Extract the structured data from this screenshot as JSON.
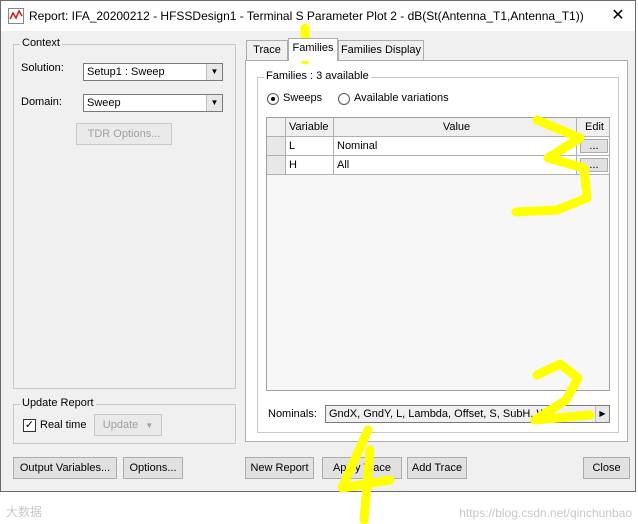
{
  "window": {
    "title": "Report: IFA_20200212 - HFSSDesign1 - Terminal S Parameter Plot 2 - dB(St(Antenna_T1,Antenna_T1))",
    "close_glyph": "✕"
  },
  "context": {
    "group_label": "Context",
    "solution_label": "Solution:",
    "solution_value": "Setup1 : Sweep",
    "domain_label": "Domain:",
    "domain_value": "Sweep",
    "tdr_button": "TDR Options..."
  },
  "update_report": {
    "group_label": "Update Report",
    "realtime_label": "Real time",
    "realtime_checked": true,
    "update_button": "Update"
  },
  "tabs": [
    {
      "label": "Trace",
      "active": false
    },
    {
      "label": "Families",
      "active": true
    },
    {
      "label": "Families Display",
      "active": false
    }
  ],
  "families": {
    "group_label": "Families : 3 available",
    "radio_sweeps": "Sweeps",
    "radio_available": "Available variations",
    "selected": "sweeps",
    "columns": [
      "Variable",
      "Value",
      "Edit"
    ],
    "rows": [
      {
        "variable": "L",
        "value": "Nominal",
        "edit": "..."
      },
      {
        "variable": "H",
        "value": "All",
        "edit": "..."
      }
    ],
    "nominals_label": "Nominals:",
    "nominals_value": "GndX, GndY, L, Lambda, Offset, S, SubH, W"
  },
  "footer": {
    "output_variables": "Output Variables...",
    "options": "Options...",
    "new_report": "New Report",
    "apply_trace": "Apply Trace",
    "add_trace": "Add Trace",
    "close": "Close"
  },
  "watermark": {
    "left": "大数据",
    "right": "https://blog.csdn.net/qinchunbao"
  },
  "annotations": [
    "1",
    "2",
    "3",
    "4"
  ],
  "colors": {
    "annotation": "#ffff00",
    "window_bg": "#f0f0f0"
  }
}
